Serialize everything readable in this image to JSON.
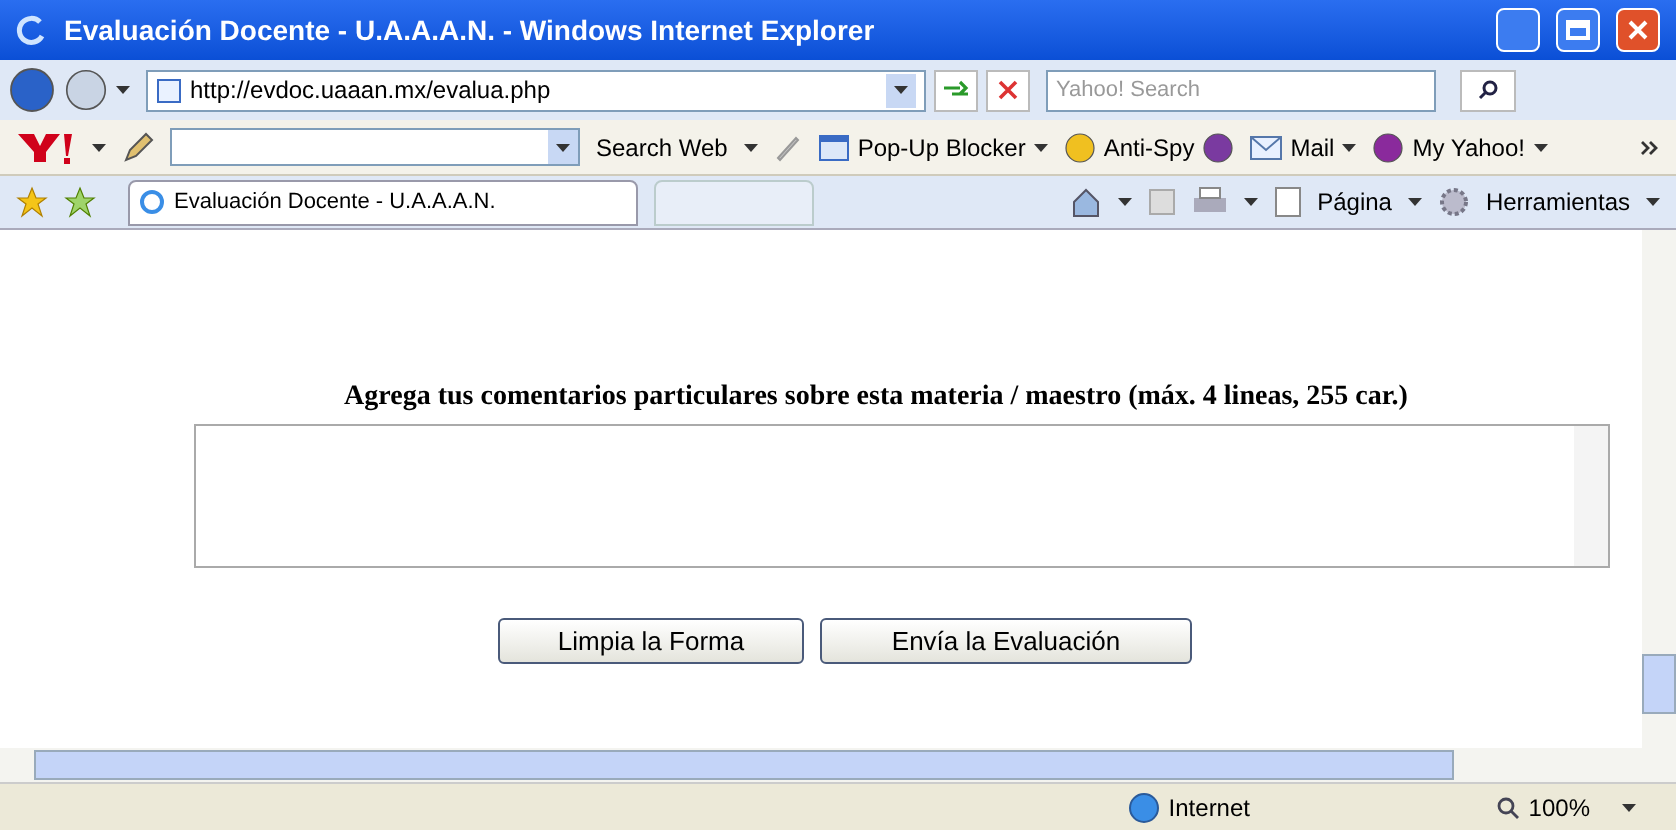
{
  "window": {
    "title": "Evaluación Docente - U.A.A.A.N. - Windows Internet Explorer"
  },
  "address_bar": {
    "url": "http://evdoc.uaaan.mx/evalua.php"
  },
  "search": {
    "placeholder": "Yahoo! Search"
  },
  "yahoo_toolbar": {
    "search_button": "Search Web",
    "items": [
      {
        "kind": "menu",
        "label": "Pop-Up Blocker"
      },
      {
        "kind": "plain",
        "label": "Anti-Spy"
      },
      {
        "kind": "menu",
        "label": "Mail"
      },
      {
        "kind": "menu",
        "label": "My Yahoo!"
      }
    ]
  },
  "tab": {
    "title": "Evaluación Docente - U.A.A.A.N."
  },
  "command_bar": {
    "items": [
      "Página",
      "Herramientas"
    ]
  },
  "page": {
    "heading": "Agrega tus comentarios particulares sobre esta materia / maestro (máx. 4 lineas, 255 car.)",
    "buttons": [
      "Limpia la Forma",
      "Envía la Evaluación"
    ]
  },
  "status_bar": {
    "zone": "Internet",
    "zoom": "100%"
  }
}
